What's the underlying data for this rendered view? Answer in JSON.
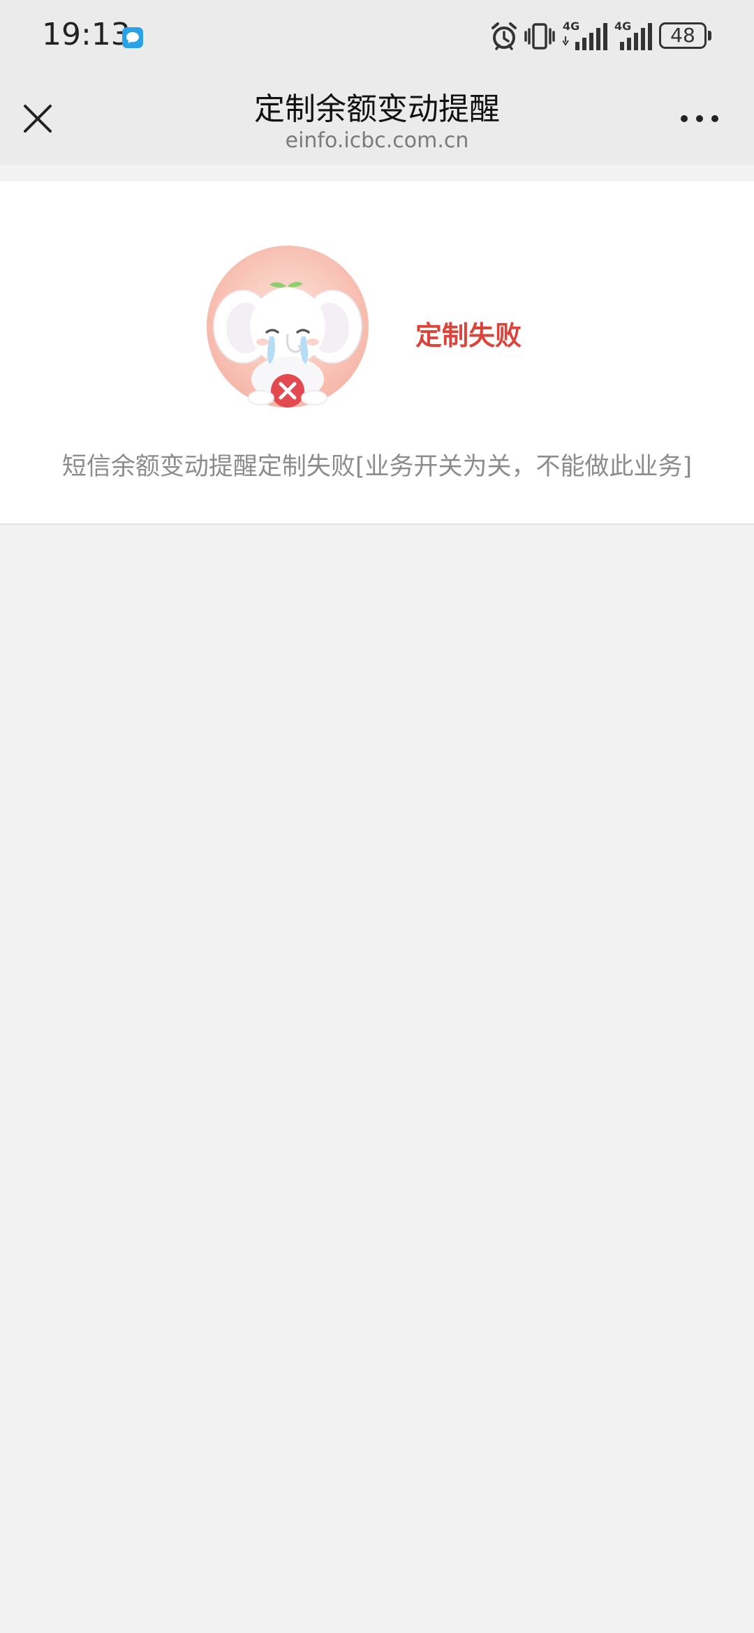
{
  "status_bar": {
    "time": "19:13",
    "battery": "48",
    "network_label_1": "4G",
    "network_label_2": "4G",
    "icons": [
      "message-icon",
      "alarm-icon",
      "vibrate-icon",
      "signal-icon",
      "signal-icon",
      "battery-icon"
    ]
  },
  "title_bar": {
    "title": "定制余额变动提醒",
    "url": "einfo.icbc.com.cn",
    "close_icon": "close-icon",
    "more_icon": "more-icon"
  },
  "result": {
    "title": "定制失败",
    "description": "短信余额变动提醒定制失败[业务开关为关，不能做此业务]",
    "title_color": "#d9443b"
  },
  "colors": {
    "background": "#f2f2f2",
    "header": "#ebebeb",
    "card": "#ffffff",
    "accent_error": "#d9443b"
  }
}
